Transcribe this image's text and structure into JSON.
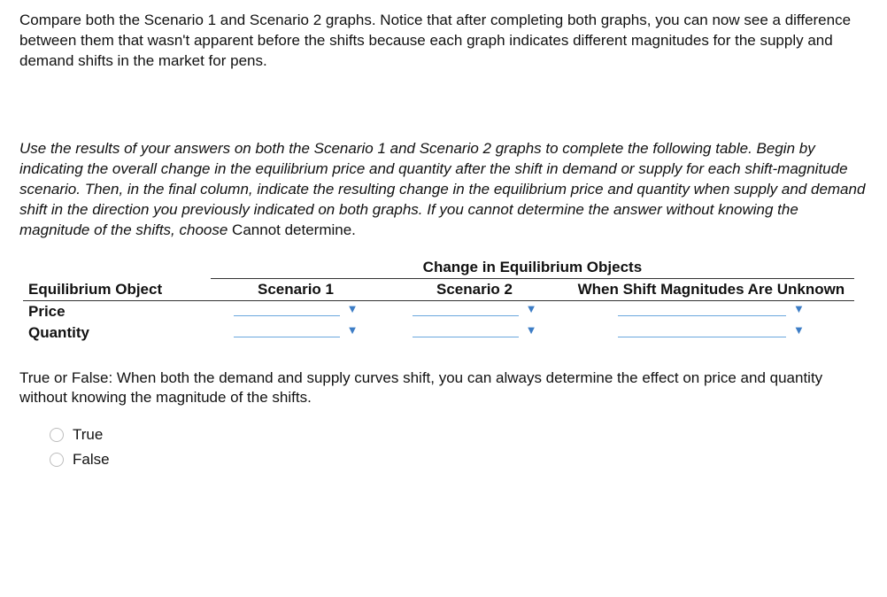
{
  "intro_text": "Compare both the Scenario 1 and Scenario 2 graphs. Notice that after completing both graphs, you can now see a difference between them that wasn't apparent before the shifts because each graph indicates different magnitudes for the supply and demand shifts in the market for pens.",
  "instructions_italic": "Use the results of your answers on both the Scenario 1 and Scenario 2 graphs to complete the following table. Begin by indicating the overall change in the equilibrium price and quantity after the shift in demand or supply for each shift-magnitude scenario. Then, in the final column, indicate the resulting change in the equilibrium price and quantity when supply and demand shift in the direction you previously indicated on both graphs. If you cannot determine the answer without knowing the magnitude of the shifts, choose ",
  "instructions_literal": "Cannot determine.",
  "table": {
    "spanning_header": "Change in Equilibrium Objects",
    "col_equilibrium": "Equilibrium Object",
    "col_scenario1": "Scenario 1",
    "col_scenario2": "Scenario 2",
    "col_unknown": "When Shift Magnitudes Are Unknown",
    "rows": [
      {
        "label": "Price"
      },
      {
        "label": "Quantity"
      }
    ]
  },
  "tf_question": "True or False: When both the demand and supply curves shift, you can always determine the effect on price and quantity without knowing the magnitude of the shifts.",
  "options": {
    "true": "True",
    "false": "False"
  }
}
